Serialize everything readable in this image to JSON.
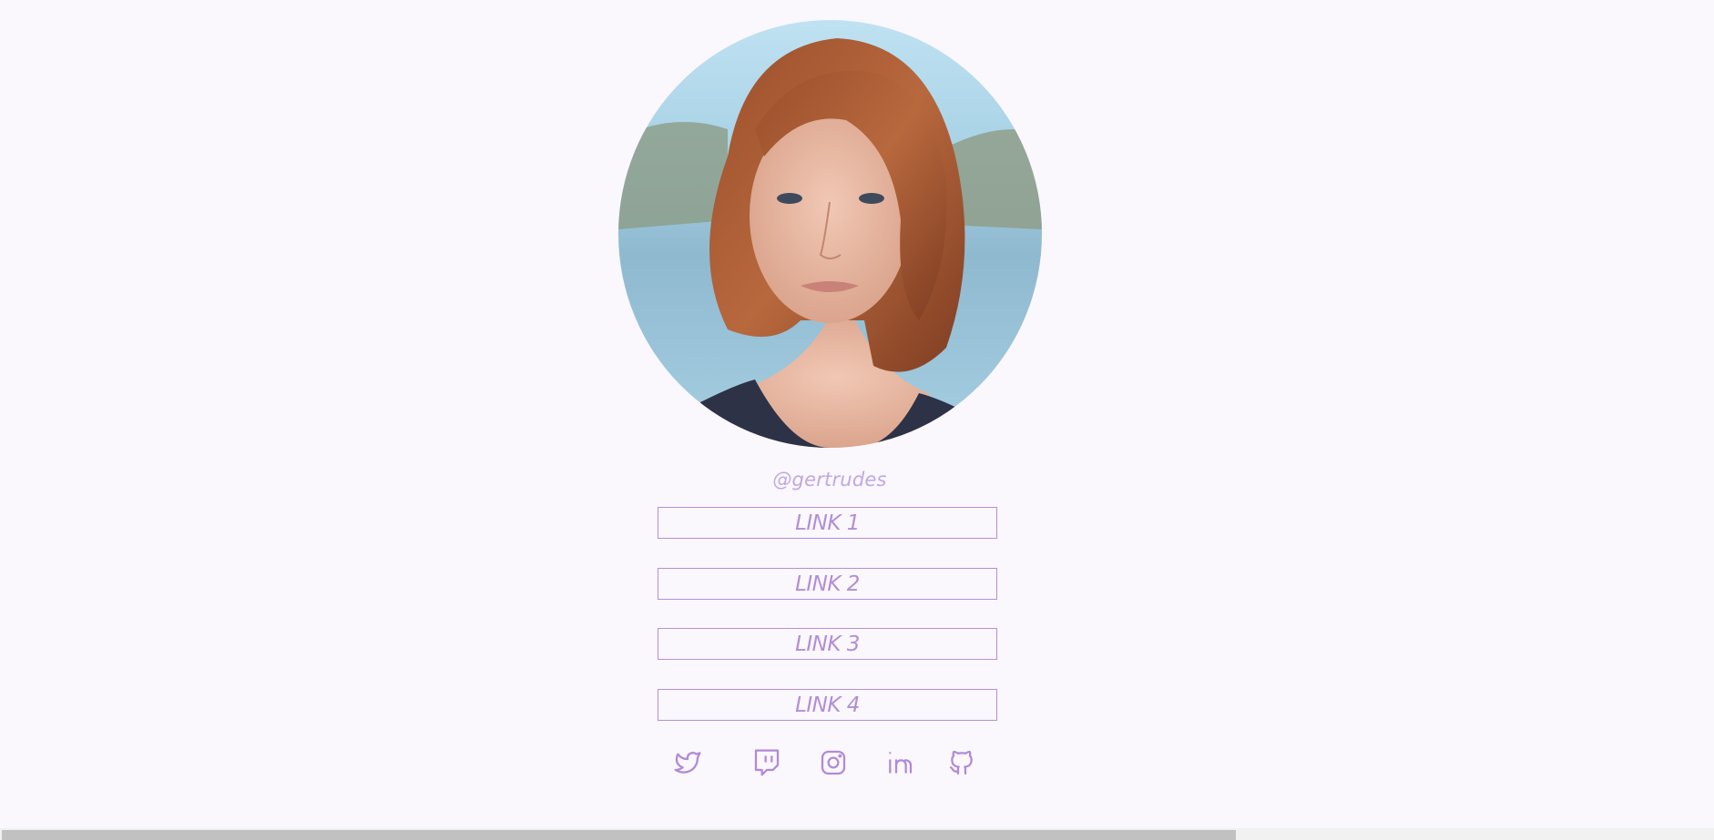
{
  "profile": {
    "username": "@gertrudes",
    "avatar_alt": "profile photo"
  },
  "links": [
    {
      "label": "LINK 1"
    },
    {
      "label": "LINK 2"
    },
    {
      "label": "LINK 3"
    },
    {
      "label": "LINK 4"
    }
  ],
  "socials": [
    {
      "icon": "twitter-icon"
    },
    {
      "icon": "twitch-icon"
    },
    {
      "icon": "instagram-icon"
    },
    {
      "icon": "linkedin-icon"
    },
    {
      "icon": "github-icon"
    }
  ],
  "colors": {
    "background": "#faf7fd",
    "accent": "#b28ed6",
    "username": "#c0a9e0"
  }
}
